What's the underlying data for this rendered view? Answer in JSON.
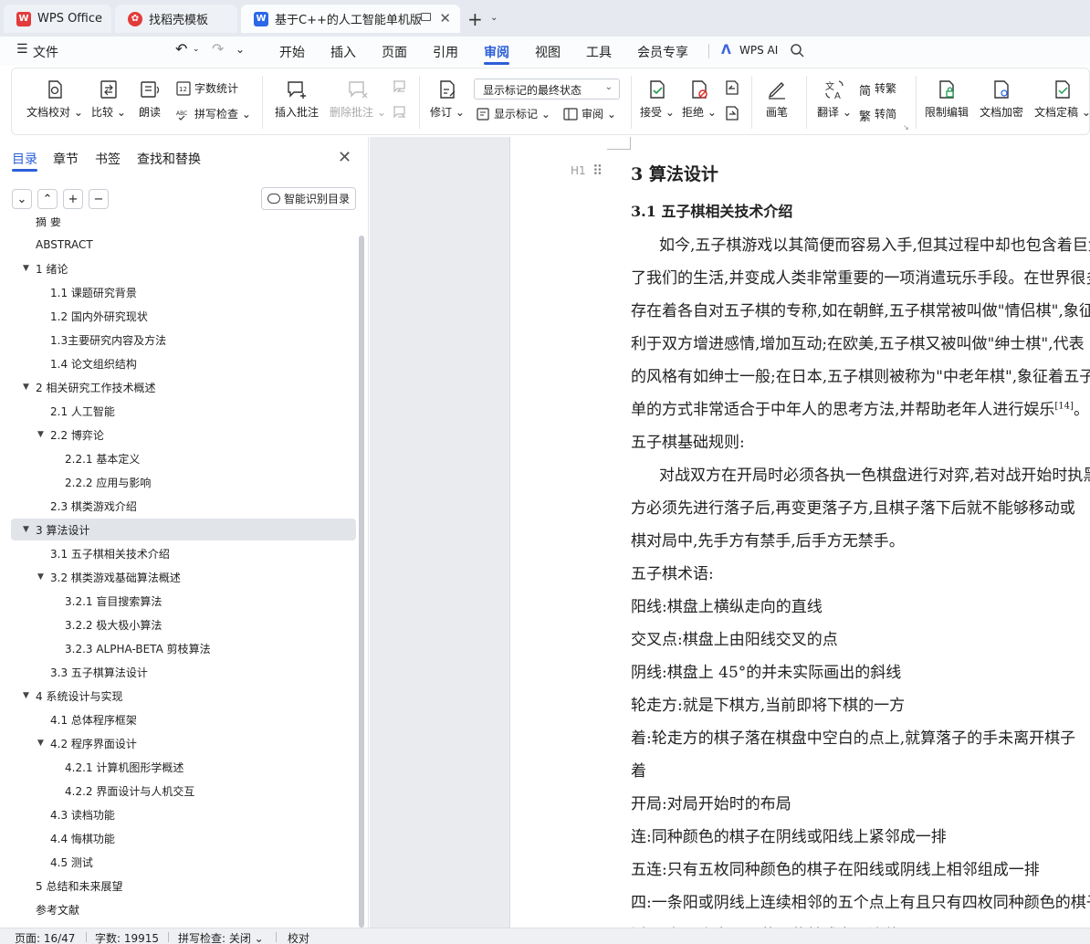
{
  "tabs": {
    "wps_office": "WPS Office",
    "templates": "找稻壳模板",
    "document": "基于C++的人工智能单机版棋类游戏设计与实现"
  },
  "menu": {
    "file": "文件",
    "items": [
      "开始",
      "插入",
      "页面",
      "引用",
      "审阅",
      "视图",
      "工具",
      "会员专享"
    ],
    "active": "审阅",
    "wps_ai": "WPS AI"
  },
  "ribbon": {
    "doc_proofread": "文档校对",
    "compare": "比较",
    "read_aloud": "朗读",
    "word_count": "字数统计",
    "spell_check": "拼写检查",
    "insert_comment": "插入批注",
    "delete_comment": "删除批注",
    "revise": "修订",
    "markup_mode": "显示标记的最终状态",
    "show_markup": "显示标记",
    "review": "审阅",
    "accept": "接受",
    "reject": "拒绝",
    "pen": "画笔",
    "translate": "翻译",
    "to_traditional": "转繁",
    "to_simplified": "转简",
    "restrict_edit": "限制编辑",
    "doc_encrypt": "文档加密",
    "doc_finalize": "文档定稿"
  },
  "nav_pane": {
    "tabs": [
      "目录",
      "章节",
      "书签",
      "查找和替换"
    ],
    "active_tab": "目录",
    "smart_toc": "智能识别目录",
    "toc": [
      {
        "label": "摘  要",
        "level": 0
      },
      {
        "label": "ABSTRACT",
        "level": 0
      },
      {
        "label": "1  绪论",
        "level": 0,
        "expanded": true
      },
      {
        "label": "1.1  课题研究背景",
        "level": 1
      },
      {
        "label": "1.2  国内外研究现状",
        "level": 1
      },
      {
        "label": "1.3主要研究内容及方法",
        "level": 1
      },
      {
        "label": "1.4  论文组织结构",
        "level": 1
      },
      {
        "label": "2  相关研究工作技术概述",
        "level": 0,
        "expanded": true
      },
      {
        "label": "2.1  人工智能",
        "level": 1
      },
      {
        "label": "2.2  博弈论",
        "level": 1,
        "expanded": true
      },
      {
        "label": "2.2.1 基本定义",
        "level": 2
      },
      {
        "label": "2.2.2 应用与影响",
        "level": 2
      },
      {
        "label": "2.3  棋类游戏介绍",
        "level": 1
      },
      {
        "label": "3  算法设计",
        "level": 0,
        "expanded": true,
        "selected": true
      },
      {
        "label": "3.1  五子棋相关技术介绍",
        "level": 1
      },
      {
        "label": "3.2  棋类游戏基础算法概述",
        "level": 1,
        "expanded": true
      },
      {
        "label": "3.2.1  盲目搜索算法",
        "level": 2
      },
      {
        "label": "3.2.2  极大极小算法",
        "level": 2
      },
      {
        "label": "3.2.3 ALPHA-BETA 剪枝算法",
        "level": 2
      },
      {
        "label": "3.3  五子棋算法设计",
        "level": 1
      },
      {
        "label": "4  系统设计与实现",
        "level": 0,
        "expanded": true
      },
      {
        "label": "4.1  总体程序框架",
        "level": 1
      },
      {
        "label": "4.2  程序界面设计",
        "level": 1,
        "expanded": true
      },
      {
        "label": "4.2.1  计算机图形学概述",
        "level": 2
      },
      {
        "label": "4.2.2  界面设计与人机交互",
        "level": 2
      },
      {
        "label": "4.3  读档功能",
        "level": 1
      },
      {
        "label": "4.4  悔棋功能",
        "level": 1
      },
      {
        "label": "4.5  测试",
        "level": 1
      },
      {
        "label": "5 总结和未来展望",
        "level": 0
      },
      {
        "label": "参考文献",
        "level": 0
      }
    ]
  },
  "document": {
    "heading_marker": "H1",
    "lines": [
      {
        "text": "3  算法设计",
        "style": "h2"
      },
      {
        "text": "3.1  五子棋相关技术介绍",
        "style": "h3"
      },
      {
        "text": "如今,五子棋游戏以其简便而容易入手,但其过程中却也包含着巨大的变化,逐渐",
        "style": "ind"
      },
      {
        "text": "了我们的生活,并变成人类非常重要的一项消遣玩乐手段。在世界很多国家和地区",
        "style": "p"
      },
      {
        "text": "存在着各自对五子棋的专称,如在朝鲜,五子棋常被叫做\"情侣棋\",象征着",
        "style": "p"
      },
      {
        "text": "利于双方增进感情,增加互动;在欧美,五子棋又被叫做\"绅士棋\",代表",
        "style": "p"
      },
      {
        "text": "的风格有如绅士一般;在日本,五子棋则被称为\"中老年棋\",象征着五子棋",
        "style": "p"
      },
      {
        "text": "单的方式非常适合于中年人的思考方法,并帮助老年人进行娱乐",
        "style": "p",
        "sup": "[14]",
        "tail": "。"
      },
      {
        "text": "五子棋基础规则:",
        "style": "p"
      },
      {
        "text": "对战双方在开局时必须各执一色棋盘进行对弈,若对战开始时执黑",
        "style": "ind"
      },
      {
        "text": "方必须先进行落子后,再变更落子方,且棋子落下后就不能够移动或",
        "style": "p"
      },
      {
        "text": "棋对局中,先手方有禁手,后手方无禁手。",
        "style": "p"
      },
      {
        "text": "五子棋术语:",
        "style": "p"
      },
      {
        "text": "阳线:棋盘上横纵走向的直线",
        "style": "p"
      },
      {
        "text": "交叉点:棋盘上由阳线交叉的点",
        "style": "p"
      },
      {
        "text": "阴线:棋盘上 45°的并未实际画出的斜线",
        "style": "p"
      },
      {
        "text": "轮走方:就是下棋方,当前即将下棋的一方",
        "style": "p"
      },
      {
        "text": "着:轮走方的棋子落在棋盘中空白的点上,就算落子的手未离开棋子",
        "style": "p"
      },
      {
        "text": "着",
        "style": "p"
      },
      {
        "text": "开局:对局开始时的布局",
        "style": "p"
      },
      {
        "text": "连:同种颜色的棋子在阴线或阳线上紧邻成一排",
        "style": "p"
      },
      {
        "text": "五连:只有五枚同种颜色的棋子在阳线或阴线上相邻组成一排",
        "style": "p"
      },
      {
        "text": "四:一条阳或阴线上连续相邻的五个点上有且只有四枚同种颜色的棋子",
        "style": "p"
      },
      {
        "text": "活四:有两个点可以落子使其成为五连的四",
        "style": "p"
      }
    ]
  },
  "status": {
    "page": "页面: 16/47",
    "words": "字数: 19915",
    "spell": "拼写检查: 关闭",
    "proofread": "校对"
  },
  "colors": {
    "accent": "#2b5fd9",
    "wps_red": "#e23b3b",
    "doc_blue": "#2b67e8"
  }
}
